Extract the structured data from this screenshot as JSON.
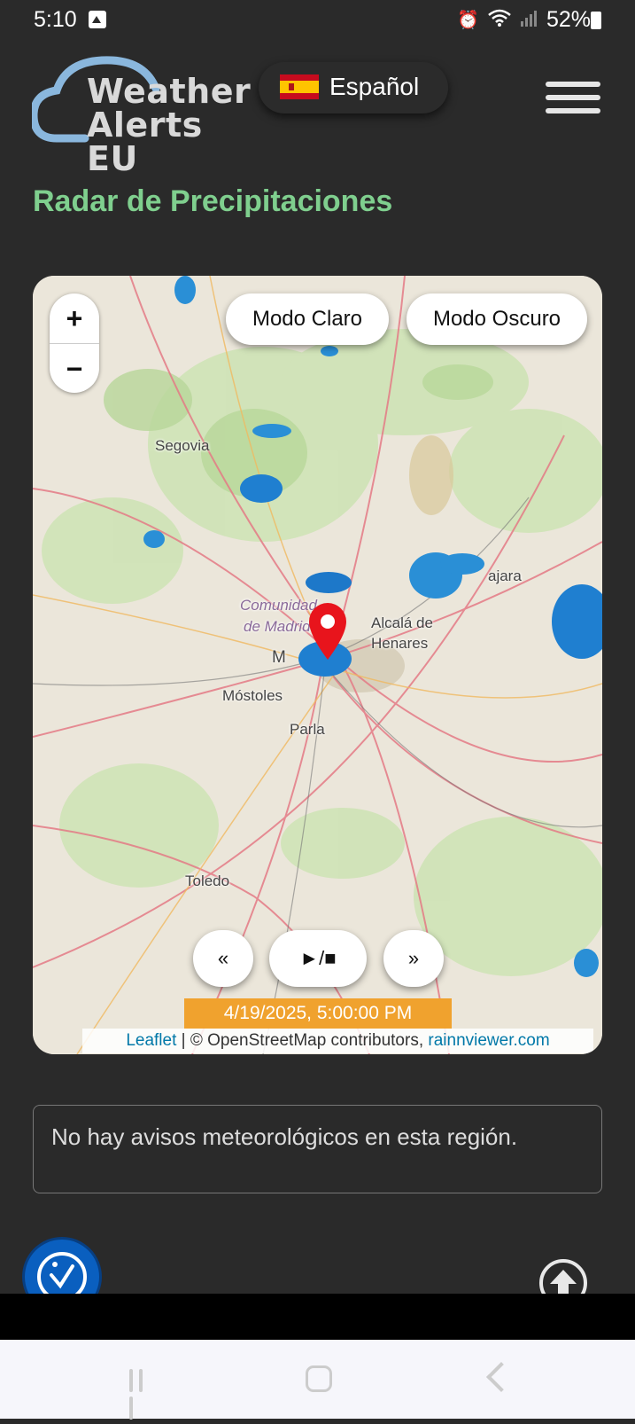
{
  "status_bar": {
    "time": "5:10",
    "battery": "52%",
    "icons": [
      "image-icon",
      "alarm-icon",
      "wifi-icon",
      "signal-icon",
      "battery-icon"
    ]
  },
  "header": {
    "logo_line1": "Weather",
    "logo_line2": "Alerts EU",
    "language": "Español",
    "language_flag": "spain-flag-icon",
    "menu_icon": "hamburger-menu-icon"
  },
  "page": {
    "title": "Radar de Precipitaciones"
  },
  "map": {
    "zoom_in": "+",
    "zoom_out": "−",
    "mode_light": "Modo Claro",
    "mode_dark": "Modo Oscuro",
    "prev": "«",
    "play_stop": "►/■",
    "next": "»",
    "timestamp": "4/19/2025, 5:00:00 PM",
    "attribution_leaflet": "Leaflet",
    "attribution_osm": " | © OpenStreetMap contributors, ",
    "attribution_rain": "rainnviewer.com",
    "place_labels": [
      "Segovia",
      "Comunidad",
      "de Madrid",
      "M",
      "Alcalá de",
      "Henares",
      "Móstoles",
      "Parla",
      "Toledo",
      "ajara"
    ]
  },
  "alerts": {
    "message": "No hay avisos meteorológicos en esta región."
  },
  "colors": {
    "background": "#2a2a2a",
    "title_green": "#7fcf8e",
    "timestamp_bg": "#f0a22e",
    "accessibility_blue": "#0a5fbf",
    "pin_red": "#e8141c"
  }
}
